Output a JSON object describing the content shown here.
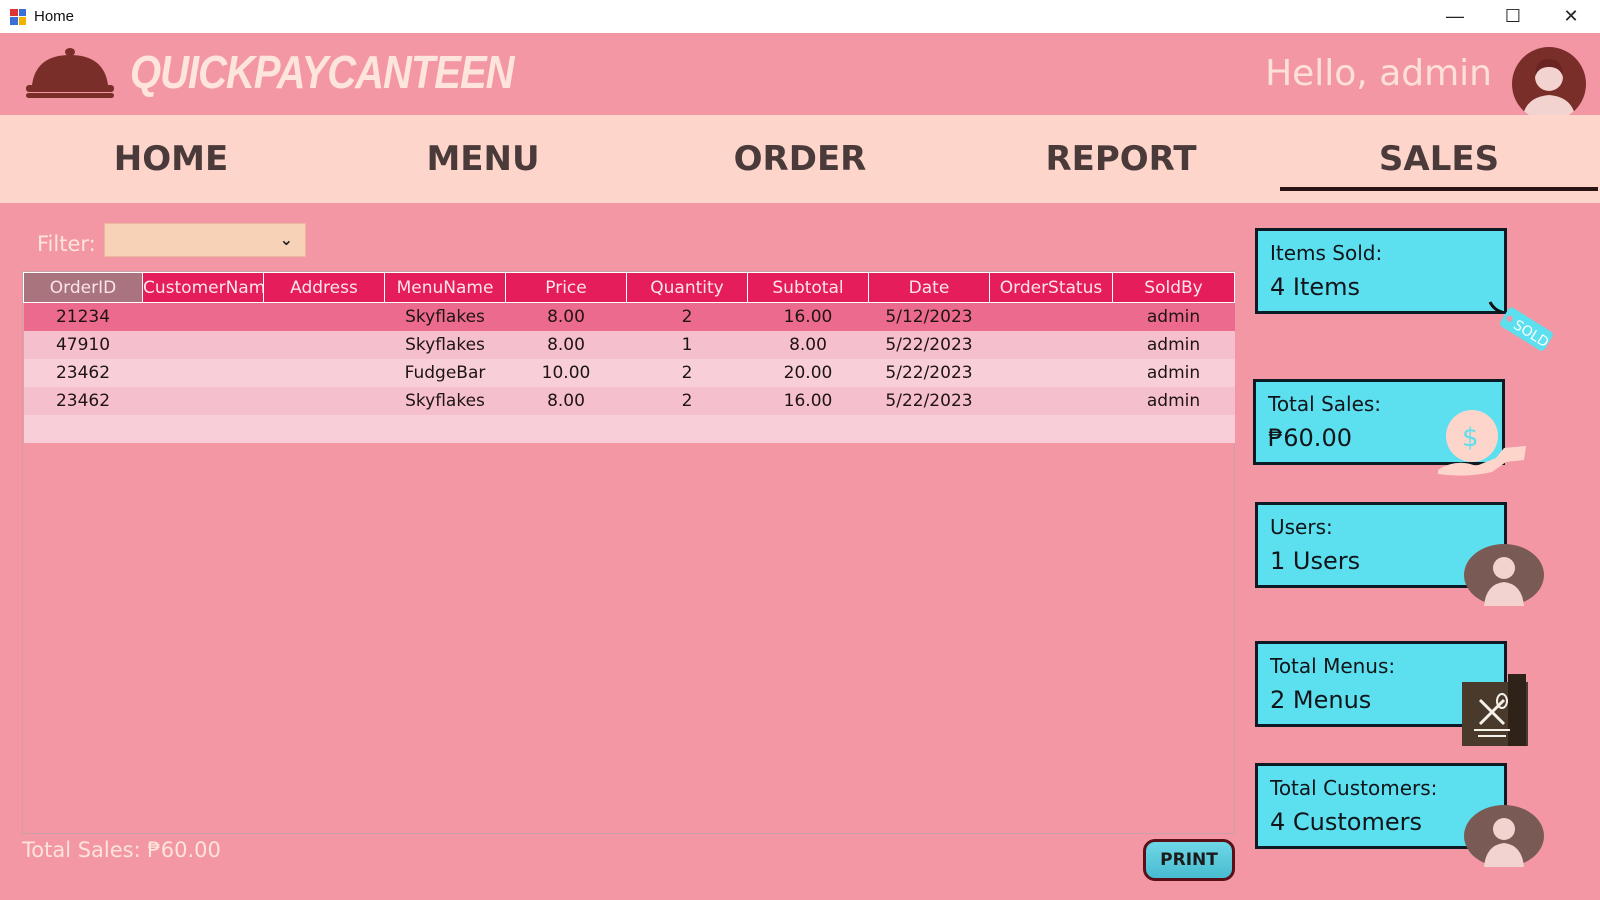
{
  "window": {
    "title": "Home",
    "controls": [
      "—",
      "☐",
      "✕"
    ]
  },
  "header": {
    "brand": "QUICKPAYCANTEEN",
    "greeting": "Hello, admin"
  },
  "nav": {
    "items": [
      {
        "label": "HOME",
        "active": false
      },
      {
        "label": "MENU",
        "active": false
      },
      {
        "label": "ORDER",
        "active": false
      },
      {
        "label": "REPORT",
        "active": false
      },
      {
        "label": "SALES",
        "active": true
      }
    ]
  },
  "filter": {
    "label": "Filter:",
    "value": ""
  },
  "table": {
    "columns": [
      "OrderID",
      "CustomerName",
      "Address",
      "MenuName",
      "Price",
      "Quantity",
      "Subtotal",
      "Date",
      "OrderStatus",
      "SoldBy"
    ],
    "rows": [
      [
        "21234",
        "",
        "",
        "Skyflakes",
        "8.00",
        "2",
        "16.00",
        "5/12/2023",
        "",
        "admin"
      ],
      [
        "47910",
        "",
        "",
        "Skyflakes",
        "8.00",
        "1",
        "8.00",
        "5/22/2023",
        "",
        "admin"
      ],
      [
        "23462",
        "",
        "",
        "FudgeBar",
        "10.00",
        "2",
        "20.00",
        "5/22/2023",
        "",
        "admin"
      ],
      [
        "23462",
        "",
        "",
        "Skyflakes",
        "8.00",
        "2",
        "16.00",
        "5/22/2023",
        "",
        "admin"
      ]
    ]
  },
  "footer": {
    "total_sales": "Total Sales: ₱60.00",
    "print_label": "PRINT"
  },
  "cards": {
    "items_sold": {
      "label": "Items Sold:",
      "value": "4 Items",
      "tag": "SOLD"
    },
    "total_sales": {
      "label": "Total Sales:",
      "value": "₱60.00"
    },
    "users": {
      "label": "Users:",
      "value": "1 Users"
    },
    "total_menus": {
      "label": "Total Menus:",
      "value": "2 Menus"
    },
    "total_customers": {
      "label": "Total Customers:",
      "value": "4 Customers"
    }
  },
  "colors": {
    "background": "#f497a5",
    "nav": "#fdd5cb",
    "header_cell": "#e51e5b",
    "card": "#5cdfee",
    "accent_dark": "#7a2e2a"
  },
  "icons": [
    "cloche-icon",
    "user-avatar-icon",
    "sold-tag-icon",
    "money-hand-icon",
    "user-icon",
    "menu-book-icon",
    "customer-icon",
    "chevron-down-icon"
  ]
}
